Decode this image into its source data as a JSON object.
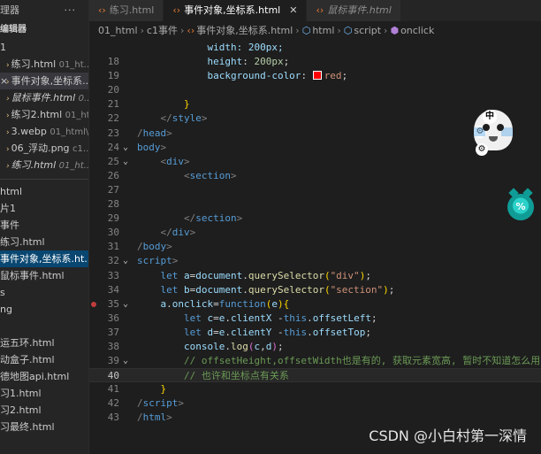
{
  "sidebar": {
    "header_title": "理器",
    "header_more": "···",
    "open_editors_title": "编辑器",
    "open_editors_count": "1",
    "open_editors": [
      {
        "name": "练习.html",
        "path": "01_ht...",
        "close": "",
        "italic": false,
        "active": false
      },
      {
        "name": "事件对象,坐标系...",
        "path": "",
        "close": "×",
        "italic": false,
        "active": false,
        "highlight": true
      },
      {
        "name": "鼠标事件.html",
        "path": "0...",
        "close": "",
        "italic": true,
        "active": false
      },
      {
        "name": "练习2.html",
        "path": "01_ht...",
        "close": "",
        "italic": false,
        "active": false
      },
      {
        "name": "3.webp",
        "path": "01_html\\...",
        "close": "",
        "italic": false,
        "active": false
      },
      {
        "name": "06_浮动.png",
        "path": "c1...",
        "close": "",
        "italic": false,
        "active": false
      },
      {
        "name": "练习.html",
        "path": "01_ht...",
        "close": "",
        "italic": true,
        "active": false
      }
    ],
    "tree": [
      {
        "name": "html",
        "active": false
      },
      {
        "name": "片1",
        "active": false
      },
      {
        "name": "事件",
        "active": false
      },
      {
        "name": "练习.html",
        "active": false
      },
      {
        "name": "事件对象,坐标系.ht...",
        "active": true
      },
      {
        "name": "鼠标事件.html",
        "active": false
      },
      {
        "name": "s",
        "active": false
      },
      {
        "name": "ng",
        "active": false
      },
      {
        "name": "",
        "active": false
      },
      {
        "name": "运五环.html",
        "active": false
      },
      {
        "name": "动盒子.html",
        "active": false
      },
      {
        "name": "德地图api.html",
        "active": false
      },
      {
        "name": "习1.html",
        "active": false
      },
      {
        "name": "习2.html",
        "active": false
      },
      {
        "name": "习最终.html",
        "active": false
      }
    ]
  },
  "tabs": [
    {
      "label": "练习.html",
      "active": false,
      "italic": false,
      "close": ""
    },
    {
      "label": "事件对象,坐标系.html",
      "active": true,
      "italic": false,
      "close": "✕"
    },
    {
      "label": "鼠标事件.html",
      "active": false,
      "italic": true,
      "close": ""
    }
  ],
  "breadcrumb": {
    "seg1": "01_html",
    "seg2": "c1事件",
    "seg3": "事件对象,坐标系.html",
    "seg4": "html",
    "seg5": "script",
    "seg6": "onclick"
  },
  "editor": {
    "lines": [
      {
        "n": "",
        "code": [
          {
            "c": "t-prop",
            "t": "            width: 200px;"
          }
        ]
      },
      {
        "n": "18",
        "code": [
          {
            "c": "t-prop",
            "t": "            height"
          },
          {
            "c": "t-op",
            "t": ": "
          },
          {
            "c": "t-num",
            "t": "200px"
          },
          {
            "c": "t-op",
            "t": ";"
          }
        ]
      },
      {
        "n": "19",
        "code": [
          {
            "c": "t-prop",
            "t": "            background-color"
          },
          {
            "c": "t-op",
            "t": ": "
          },
          {
            "c": "swatch",
            "t": ""
          },
          {
            "c": "t-val",
            "t": "red"
          },
          {
            "c": "t-op",
            "t": ";"
          }
        ]
      },
      {
        "n": "20",
        "code": [
          {
            "c": "t-op",
            "t": ""
          }
        ]
      },
      {
        "n": "21",
        "code": [
          {
            "c": "t-br",
            "t": "        }"
          }
        ]
      },
      {
        "n": "22",
        "code": [
          {
            "c": "t-punc",
            "t": "    </"
          },
          {
            "c": "t-tag",
            "t": "style"
          },
          {
            "c": "t-punc",
            "t": ">"
          }
        ]
      },
      {
        "n": "23",
        "code": [
          {
            "c": "t-punc",
            "t": "/"
          },
          {
            "c": "t-tag",
            "t": "head"
          },
          {
            "c": "t-punc",
            "t": ">"
          }
        ]
      },
      {
        "n": "24",
        "fold": "⌄",
        "code": [
          {
            "c": "t-tag",
            "t": "body"
          },
          {
            "c": "t-punc",
            "t": ">"
          }
        ]
      },
      {
        "n": "25",
        "fold": "⌄",
        "code": [
          {
            "c": "t-punc",
            "t": "    <"
          },
          {
            "c": "t-tag",
            "t": "div"
          },
          {
            "c": "t-punc",
            "t": ">"
          }
        ]
      },
      {
        "n": "26",
        "code": [
          {
            "c": "t-punc",
            "t": "        <"
          },
          {
            "c": "t-tag",
            "t": "section"
          },
          {
            "c": "t-punc",
            "t": ">"
          }
        ]
      },
      {
        "n": "27",
        "code": [
          {
            "c": "t-op",
            "t": ""
          }
        ]
      },
      {
        "n": "28",
        "code": [
          {
            "c": "t-op",
            "t": ""
          }
        ]
      },
      {
        "n": "29",
        "code": [
          {
            "c": "t-punc",
            "t": "        </"
          },
          {
            "c": "t-tag",
            "t": "section"
          },
          {
            "c": "t-punc",
            "t": ">"
          }
        ]
      },
      {
        "n": "30",
        "code": [
          {
            "c": "t-punc",
            "t": "    </"
          },
          {
            "c": "t-tag",
            "t": "div"
          },
          {
            "c": "t-punc",
            "t": ">"
          }
        ]
      },
      {
        "n": "31",
        "code": [
          {
            "c": "t-punc",
            "t": "/"
          },
          {
            "c": "t-tag",
            "t": "body"
          },
          {
            "c": "t-punc",
            "t": ">"
          }
        ]
      },
      {
        "n": "32",
        "fold": "⌄",
        "code": [
          {
            "c": "t-tag",
            "t": "script"
          },
          {
            "c": "t-punc",
            "t": ">"
          }
        ]
      },
      {
        "n": "33",
        "code": [
          {
            "c": "t-kw",
            "t": "    let "
          },
          {
            "c": "t-var",
            "t": "a"
          },
          {
            "c": "t-op",
            "t": "="
          },
          {
            "c": "t-var",
            "t": "document"
          },
          {
            "c": "t-op",
            "t": "."
          },
          {
            "c": "t-fn",
            "t": "querySelector"
          },
          {
            "c": "t-br",
            "t": "("
          },
          {
            "c": "t-str",
            "t": "\"div\""
          },
          {
            "c": "t-br",
            "t": ")"
          },
          {
            "c": "t-op",
            "t": ";"
          }
        ]
      },
      {
        "n": "34",
        "code": [
          {
            "c": "t-kw",
            "t": "    let "
          },
          {
            "c": "t-var",
            "t": "b"
          },
          {
            "c": "t-op",
            "t": "="
          },
          {
            "c": "t-var",
            "t": "document"
          },
          {
            "c": "t-op",
            "t": "."
          },
          {
            "c": "t-fn",
            "t": "querySelector"
          },
          {
            "c": "t-br",
            "t": "("
          },
          {
            "c": "t-str",
            "t": "\"section\""
          },
          {
            "c": "t-br",
            "t": ")"
          },
          {
            "c": "t-op",
            "t": ";"
          }
        ]
      },
      {
        "n": "35",
        "fold": "⌄",
        "bp": true,
        "code": [
          {
            "c": "t-var",
            "t": "    a"
          },
          {
            "c": "t-op",
            "t": "."
          },
          {
            "c": "t-var",
            "t": "onclick"
          },
          {
            "c": "t-op",
            "t": "="
          },
          {
            "c": "t-kw",
            "t": "function"
          },
          {
            "c": "t-br",
            "t": "("
          },
          {
            "c": "t-var",
            "t": "e"
          },
          {
            "c": "t-br",
            "t": ")"
          },
          {
            "c": "t-br",
            "t": "{"
          }
        ]
      },
      {
        "n": "36",
        "code": [
          {
            "c": "t-kw",
            "t": "        let "
          },
          {
            "c": "t-var",
            "t": "c"
          },
          {
            "c": "t-op",
            "t": "="
          },
          {
            "c": "t-var",
            "t": "e"
          },
          {
            "c": "t-op",
            "t": "."
          },
          {
            "c": "t-var",
            "t": "clientX"
          },
          {
            "c": "t-op",
            "t": " -"
          },
          {
            "c": "t-this",
            "t": "this"
          },
          {
            "c": "t-op",
            "t": "."
          },
          {
            "c": "t-var",
            "t": "offsetLeft"
          },
          {
            "c": "t-op",
            "t": ";"
          }
        ]
      },
      {
        "n": "37",
        "code": [
          {
            "c": "t-kw",
            "t": "        let "
          },
          {
            "c": "t-var",
            "t": "d"
          },
          {
            "c": "t-op",
            "t": "="
          },
          {
            "c": "t-var",
            "t": "e"
          },
          {
            "c": "t-op",
            "t": "."
          },
          {
            "c": "t-var",
            "t": "clientY"
          },
          {
            "c": "t-op",
            "t": " -"
          },
          {
            "c": "t-this",
            "t": "this"
          },
          {
            "c": "t-op",
            "t": "."
          },
          {
            "c": "t-var",
            "t": "offsetTop"
          },
          {
            "c": "t-op",
            "t": ";"
          }
        ]
      },
      {
        "n": "38",
        "code": [
          {
            "c": "t-var",
            "t": "        console"
          },
          {
            "c": "t-op",
            "t": "."
          },
          {
            "c": "t-fn",
            "t": "log"
          },
          {
            "c": "t-br2",
            "t": "("
          },
          {
            "c": "t-var",
            "t": "c"
          },
          {
            "c": "t-op",
            "t": ","
          },
          {
            "c": "t-var",
            "t": "d"
          },
          {
            "c": "t-br2",
            "t": ")"
          },
          {
            "c": "t-op",
            "t": ";"
          }
        ]
      },
      {
        "n": "39",
        "fold": "⌄",
        "code": [
          {
            "c": "t-com",
            "t": "        // offsetHeight,offsetWidth也是有的, 获取元素宽高, 暂时不知道怎么用"
          }
        ]
      },
      {
        "n": "40",
        "cur": true,
        "code": [
          {
            "c": "t-com",
            "t": "        // 也许和坐标点有关系"
          }
        ]
      },
      {
        "n": "41",
        "code": [
          {
            "c": "t-br",
            "t": "    }"
          }
        ]
      },
      {
        "n": "42",
        "code": [
          {
            "c": "t-punc",
            "t": "/"
          },
          {
            "c": "t-tag",
            "t": "script"
          },
          {
            "c": "t-punc",
            "t": ">"
          }
        ]
      },
      {
        "n": "43",
        "code": [
          {
            "c": "t-punc",
            "t": "/"
          },
          {
            "c": "t-tag",
            "t": "html"
          },
          {
            "c": "t-punc",
            "t": ">"
          }
        ]
      }
    ]
  },
  "widgets": {
    "zh_label": "中",
    "gear_icon": "gear-icon",
    "ball_label": "%"
  },
  "watermark": "CSDN @小白村第一深情",
  "colors": {
    "accent": "#094771",
    "breakpoint": "#c03c3c",
    "swatch_red": "#ff0000"
  }
}
